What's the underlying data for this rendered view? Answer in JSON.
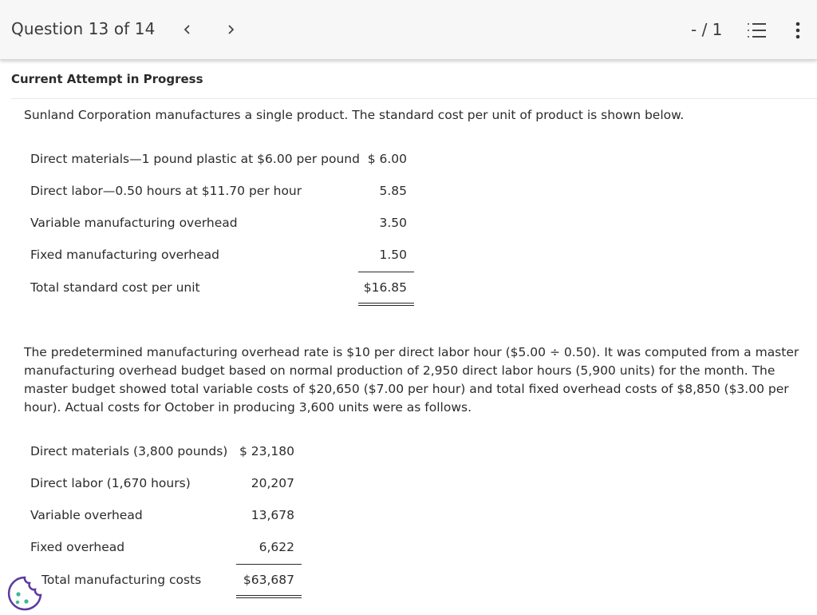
{
  "header": {
    "question_label": "Question 13 of 14",
    "score": "- / 1",
    "icons": {
      "prev": "chevron-left-icon",
      "next": "chevron-right-icon",
      "list": "numbered-list-icon",
      "more": "vertical-dots-icon"
    }
  },
  "attempt_label": "Current Attempt in Progress",
  "intro": "Sunland Corporation manufactures a single product. The standard cost per unit of product is shown below.",
  "standard_cost": {
    "rows": [
      {
        "label": "Direct materials—1 pound plastic at $6.00 per pound",
        "amount": "$ 6.00"
      },
      {
        "label": "Direct labor—0.50 hours at $11.70 per hour",
        "amount": "5.85"
      },
      {
        "label": "Variable manufacturing overhead",
        "amount": "3.50"
      },
      {
        "label": "Fixed manufacturing overhead",
        "amount": "1.50"
      }
    ],
    "total": {
      "label": "Total standard cost per unit",
      "amount": "$16.85"
    }
  },
  "paragraph": "The predetermined manufacturing overhead rate is $10 per direct labor hour ($5.00 ÷ 0.50). It was computed from a master manufacturing overhead budget based on normal production of 2,950 direct labor hours (5,900 units) for the month. The master budget showed total variable costs of $20,650 ($7.00 per hour) and total fixed overhead costs of $8,850 ($3.00 per hour). Actual costs for October in producing 3,600 units were as follows.",
  "actual_costs": {
    "rows": [
      {
        "label": "Direct materials (3,800 pounds)",
        "amount": "$ 23,180"
      },
      {
        "label": "Direct labor (1,670 hours)",
        "amount": "20,207"
      },
      {
        "label": "Variable overhead",
        "amount": "13,678"
      },
      {
        "label": "Fixed overhead",
        "amount": "6,622"
      }
    ],
    "total": {
      "label": "Total manufacturing costs",
      "amount": "$63,687"
    }
  },
  "cookie_icon": "cookie-icon",
  "colors": {
    "accent": "#5b3a9e",
    "text": "#2b2b2b",
    "topbar": "#f7f7f7"
  }
}
